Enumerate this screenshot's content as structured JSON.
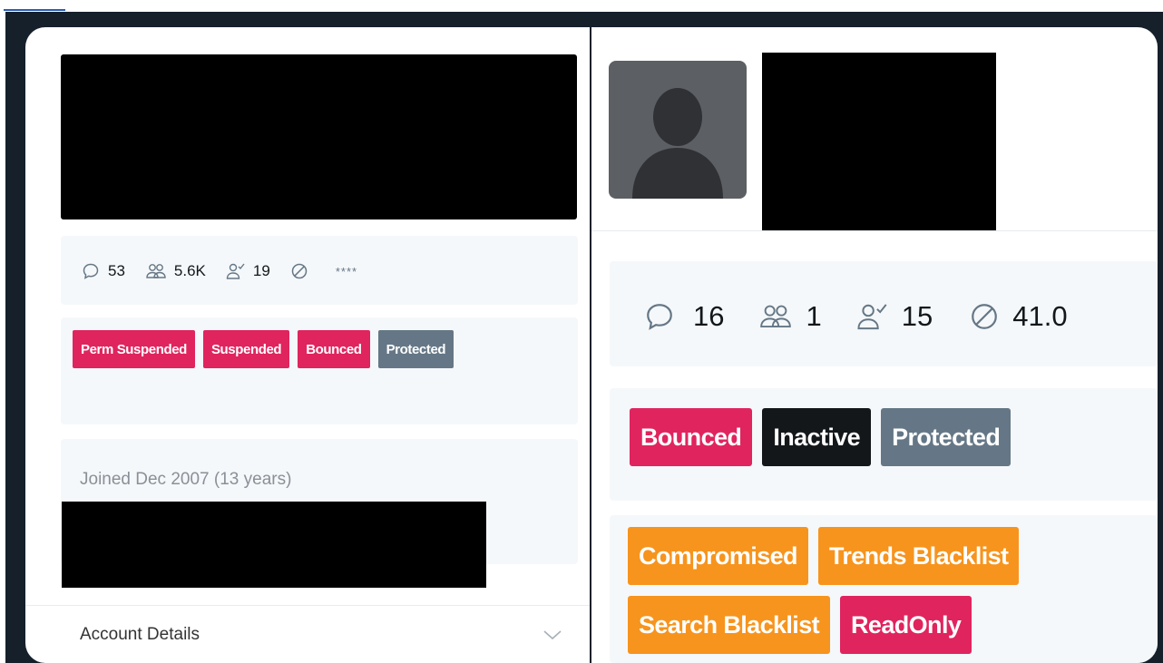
{
  "left_card": {
    "stats": {
      "replies": "53",
      "followers": "5.6K",
      "following": "19",
      "blocked": "****"
    },
    "badges": [
      {
        "label": "Perm Suspended",
        "color": "#e0245e"
      },
      {
        "label": "Suspended",
        "color": "#e0245e"
      },
      {
        "label": "Bounced",
        "color": "#e0245e"
      },
      {
        "label": "Protected",
        "color": "#657786"
      }
    ],
    "joined": "Joined Dec 2007 (13 years)",
    "account_details_label": "Account Details"
  },
  "right_card": {
    "stats": {
      "replies": "16",
      "followers": "1",
      "following": "15",
      "blocked": "41.0"
    },
    "badges_row1": [
      {
        "label": "Bounced",
        "color": "#e0245e"
      },
      {
        "label": "Inactive",
        "color": "#14171a"
      },
      {
        "label": "Protected",
        "color": "#657786"
      }
    ],
    "badges_row2": [
      {
        "label": "Compromised",
        "color": "#f7941d"
      },
      {
        "label": "Trends Blacklist",
        "color": "#f7941d"
      },
      {
        "label": "Search Blacklist",
        "color": "#f7941d"
      },
      {
        "label": "ReadOnly",
        "color": "#e0245e"
      }
    ]
  },
  "icons": [
    "comment-icon",
    "followers-icon",
    "following-icon",
    "blocked-icon",
    "chevron-down-icon",
    "default-avatar-icon"
  ]
}
